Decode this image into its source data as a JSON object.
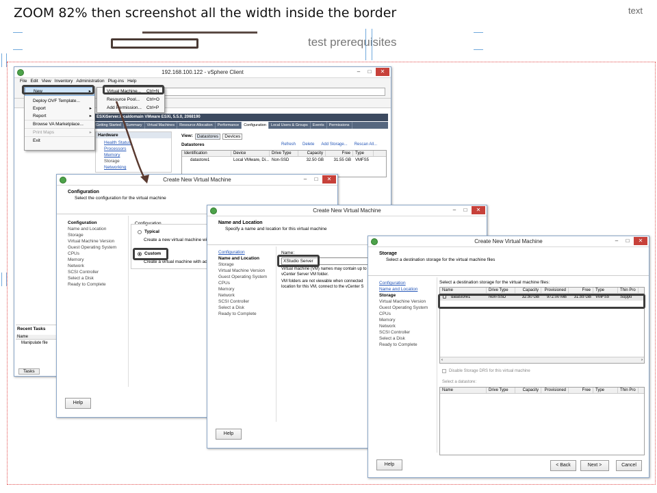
{
  "slide": {
    "title": "ZOOM 82% then screenshot all the width inside the border",
    "corner_text": "text",
    "subtitle": "test prerequisites"
  },
  "vsphere": {
    "title": "192.168.100.122 - vSphere Client",
    "menubar": [
      "File",
      "Edit",
      "View",
      "Inventory",
      "Administration",
      "Plug-ins",
      "Help"
    ],
    "file_menu": [
      {
        "label": "New",
        "arrow": true
      },
      {
        "label": "Deploy OVF Template..."
      },
      {
        "label": "Export",
        "arrow": true
      },
      {
        "label": "Report",
        "arrow": true
      },
      {
        "label": "Browse VA Marketplace..."
      },
      {
        "label": "Print Maps",
        "arrow": true
      },
      {
        "label": "Exit"
      }
    ],
    "new_submenu": [
      {
        "label": "Virtual Machine...",
        "shortcut": "Ctrl+N"
      },
      {
        "label": "Resource Pool...",
        "shortcut": "Ctrl+O"
      },
      {
        "label": "Add Permission...",
        "shortcut": "Ctrl+P"
      }
    ],
    "host_bar": "ESXiServer.localdomain VMware ESXi, 5.5.0, 2068190",
    "tabs": [
      "Getting Started",
      "Summary",
      "Virtual Machines",
      "Resource Allocation",
      "Performance",
      "Configuration",
      "Local Users & Groups",
      "Events",
      "Permissions"
    ],
    "hardware_header": "Hardware",
    "hardware_items": [
      "Health Status",
      "Processors",
      "Memory",
      "Storage",
      "Networking"
    ],
    "view_label": "View:",
    "view_buttons": [
      "Datastores",
      "Devices"
    ],
    "datastores_label": "Datastores",
    "ds_actions": [
      "Refresh",
      "Delete",
      "Add Storage...",
      "Rescan All..."
    ],
    "ds_columns": [
      "Identification",
      "Device",
      "Drive Type",
      "Capacity",
      "Free",
      "Type"
    ],
    "ds_row": [
      "datastore1",
      "Local VMware, Di...",
      "Non-SSD",
      "32.50 GB",
      "31.55 GB",
      "VMFS5"
    ],
    "recent_tasks": "Recent Tasks",
    "tasks_col": "Name",
    "tasks_row": "Manipulate file",
    "tasks_tab": "Tasks"
  },
  "wizard1": {
    "title": "Create New Virtual Machine",
    "header": "Configuration",
    "subheader": "Select the configuration for the virtual machine",
    "nav": [
      "Configuration",
      "Name and Location",
      "Storage",
      "Virtual Machine Version",
      "Guest Operating System",
      "CPUs",
      "Memory",
      "Network",
      "SCSI Controller",
      "Select a Disk",
      "Ready to Complete"
    ],
    "group_label": "Configuration",
    "typical_label": "Typical",
    "typical_desc": "Create a new virtual machine with",
    "custom_label": "Custom",
    "custom_desc": "Create a virtual machine with add",
    "help": "Help"
  },
  "wizard2": {
    "title": "Create New Virtual Machine",
    "header": "Name and Location",
    "subheader": "Specify a name and location for this virtual machine",
    "nav": [
      "Configuration",
      "Name and Location",
      "Storage",
      "Virtual Machine Version",
      "Guest Operating System",
      "CPUs",
      "Memory",
      "Network",
      "SCSI Controller",
      "Select a Disk",
      "Ready to Complete"
    ],
    "name_label": "Name:",
    "name_value": "XStudio Server",
    "note1": "Virtual machine (VM) names may contain up to",
    "note2": "vCenter Server VM folder.",
    "note3": "VM folders are not viewable when connected",
    "note4": "location for this VM, connect to the vCenter S",
    "help": "Help"
  },
  "wizard3": {
    "title": "Create New Virtual Machine",
    "header": "Storage",
    "subheader": "Select a destination storage for the virtual machine files",
    "nav": [
      "Configuration",
      "Name and Location",
      "Storage",
      "Virtual Machine Version",
      "Guest Operating System",
      "CPUs",
      "Memory",
      "Network",
      "SCSI Controller",
      "Select a Disk",
      "Ready to Complete"
    ],
    "select_label": "Select a destination storage for the virtual machine files:",
    "columns": [
      "Name",
      "Drive Type",
      "Capacity",
      "Provisioned",
      "Free",
      "Type",
      "Thin Pro"
    ],
    "row": [
      "datastore1",
      "Non-SSD",
      "32.50 GB",
      "972.00 MB",
      "31.55 GB",
      "VMFS5",
      "Suppo"
    ],
    "disable_drs": "Disable Storage DRS for this virtual machine",
    "select_datastore": "Select a datastore:",
    "columns2": [
      "Name",
      "Drive Type",
      "Capacity",
      "Provisioned",
      "Free",
      "Type",
      "Thin Pro"
    ],
    "help": "Help",
    "back": "< Back",
    "next": "Next >",
    "cancel": "Cancel"
  },
  "colors": {
    "accent_border": "#3c3c3c",
    "red_dotted": "#e24a4a",
    "guide": "#6fa8dc",
    "tab_bar": "#56677f",
    "link": "#2456b8"
  }
}
